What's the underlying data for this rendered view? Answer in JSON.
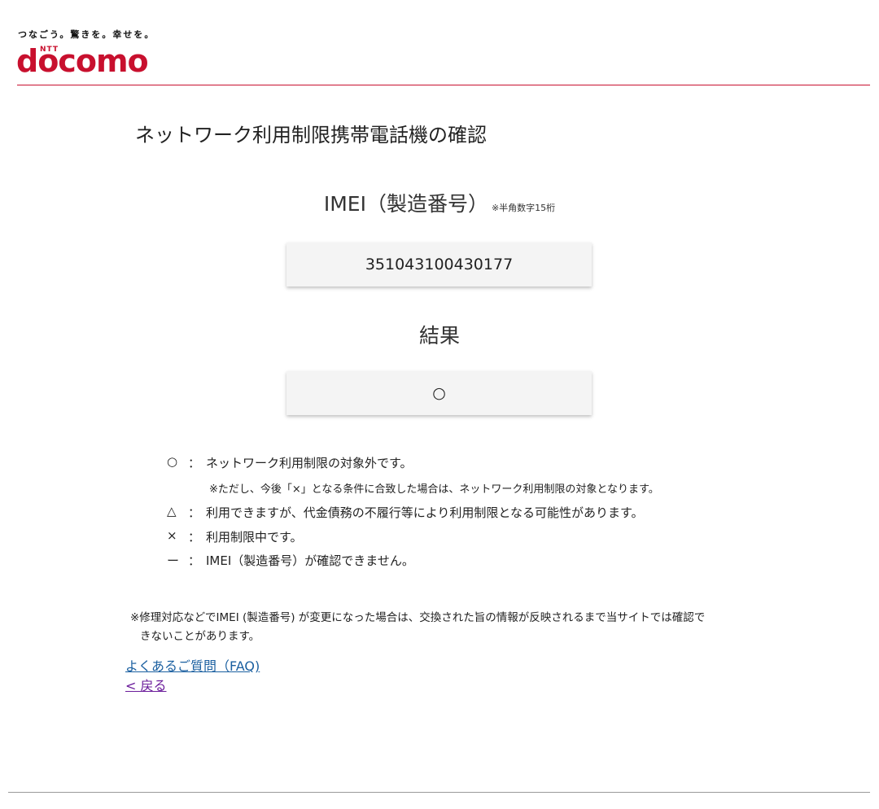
{
  "header": {
    "tagline": "つなごう。驚きを。幸せを。",
    "logo_small": "NTT",
    "logo": "docomo"
  },
  "page": {
    "title": "ネットワーク利用制限携帯電話機の確認"
  },
  "imei": {
    "label": "IMEI（製造番号）",
    "note": "※半角数字15桁",
    "value": "351043100430177"
  },
  "result": {
    "label": "結果",
    "value": "○"
  },
  "legend": {
    "rows": [
      {
        "symbol": "○",
        "colon": "：",
        "text": "ネットワーク利用制限の対象外です。"
      },
      {
        "symbol": "△",
        "colon": "：",
        "text": "利用できますが、代金債務の不履行等により利用制限となる可能性があります。"
      },
      {
        "symbol": "×",
        "colon": "：",
        "text": "利用制限中です。"
      },
      {
        "symbol": "ー",
        "colon": "：",
        "text": "IMEI（製造番号）が確認できません。"
      }
    ],
    "sub_note": "※ただし、今後「×」となる条件に合致した場合は、ネットワーク利用制限の対象となります。"
  },
  "notice": {
    "line1": "※修理対応などでIMEI (製造番号) が変更になった場合は、交換された旨の情報が反映されるまで当サイトでは確認で",
    "line2": "きないことがあります。"
  },
  "links": {
    "faq": "よくあるご質問（FAQ)",
    "back": "< 戻る"
  },
  "colors": {
    "brand": "#c8102e",
    "link": "#1a5fa0",
    "visited_link": "#6a1b9a",
    "box_bg": "#f4f4f4"
  }
}
